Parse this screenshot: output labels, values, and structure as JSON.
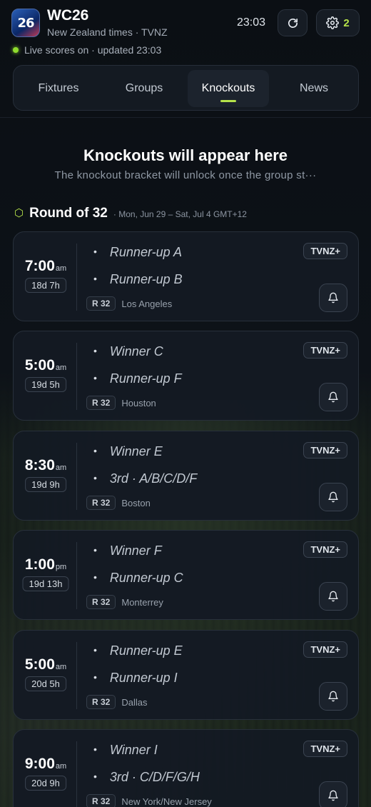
{
  "header": {
    "logo_text": "26",
    "title": "WC26",
    "subtitle": "New Zealand times · TVNZ",
    "time": "23:03",
    "settings_count": "2"
  },
  "live": {
    "text": "Live scores on · updated 23:03"
  },
  "tabs": [
    {
      "label": "Fixtures",
      "active": false
    },
    {
      "label": "Groups",
      "active": false
    },
    {
      "label": "Knockouts",
      "active": true
    },
    {
      "label": "News",
      "active": false
    }
  ],
  "knockouts": {
    "title": "Knockouts will appear here",
    "subtitle": "The knockout bracket will unlock once the group st···"
  },
  "round": {
    "title": "Round of 32",
    "dates": "· Mon, Jun 29 – Sat, Jul 4 GMT+12"
  },
  "matches": [
    {
      "time": "7:00",
      "ampm": "am",
      "countdown": "18d 7h",
      "team1": "Runner-up A",
      "team2": "Runner-up B",
      "round": "R 32",
      "venue": "Los Angeles",
      "broadcaster": "TVNZ+"
    },
    {
      "time": "5:00",
      "ampm": "am",
      "countdown": "19d 5h",
      "team1": "Winner C",
      "team2": "Runner-up F",
      "round": "R 32",
      "venue": "Houston",
      "broadcaster": "TVNZ+"
    },
    {
      "time": "8:30",
      "ampm": "am",
      "countdown": "19d 9h",
      "team1": "Winner E",
      "team2": "3rd · A/B/C/D/F",
      "round": "R 32",
      "venue": "Boston",
      "broadcaster": "TVNZ+"
    },
    {
      "time": "1:00",
      "ampm": "pm",
      "countdown": "19d 13h",
      "team1": "Winner F",
      "team2": "Runner-up C",
      "round": "R 32",
      "venue": "Monterrey",
      "broadcaster": "TVNZ+"
    },
    {
      "time": "5:00",
      "ampm": "am",
      "countdown": "20d 5h",
      "team1": "Runner-up E",
      "team2": "Runner-up I",
      "round": "R 32",
      "venue": "Dallas",
      "broadcaster": "TVNZ+"
    },
    {
      "time": "9:00",
      "ampm": "am",
      "countdown": "20d 9h",
      "team1": "Winner I",
      "team2": "3rd · C/D/F/G/H",
      "round": "R 32",
      "venue": "New York/New Jersey",
      "broadcaster": "TVNZ+"
    }
  ],
  "icons": {
    "refresh": "refresh-icon",
    "settings": "gear-icon",
    "bell": "bell-icon",
    "round_marker": "hexagon-icon"
  },
  "colors": {
    "accent": "#b6e34a",
    "live": "#8fdc2e",
    "background": "#0b0f14",
    "card": "#141a23"
  }
}
